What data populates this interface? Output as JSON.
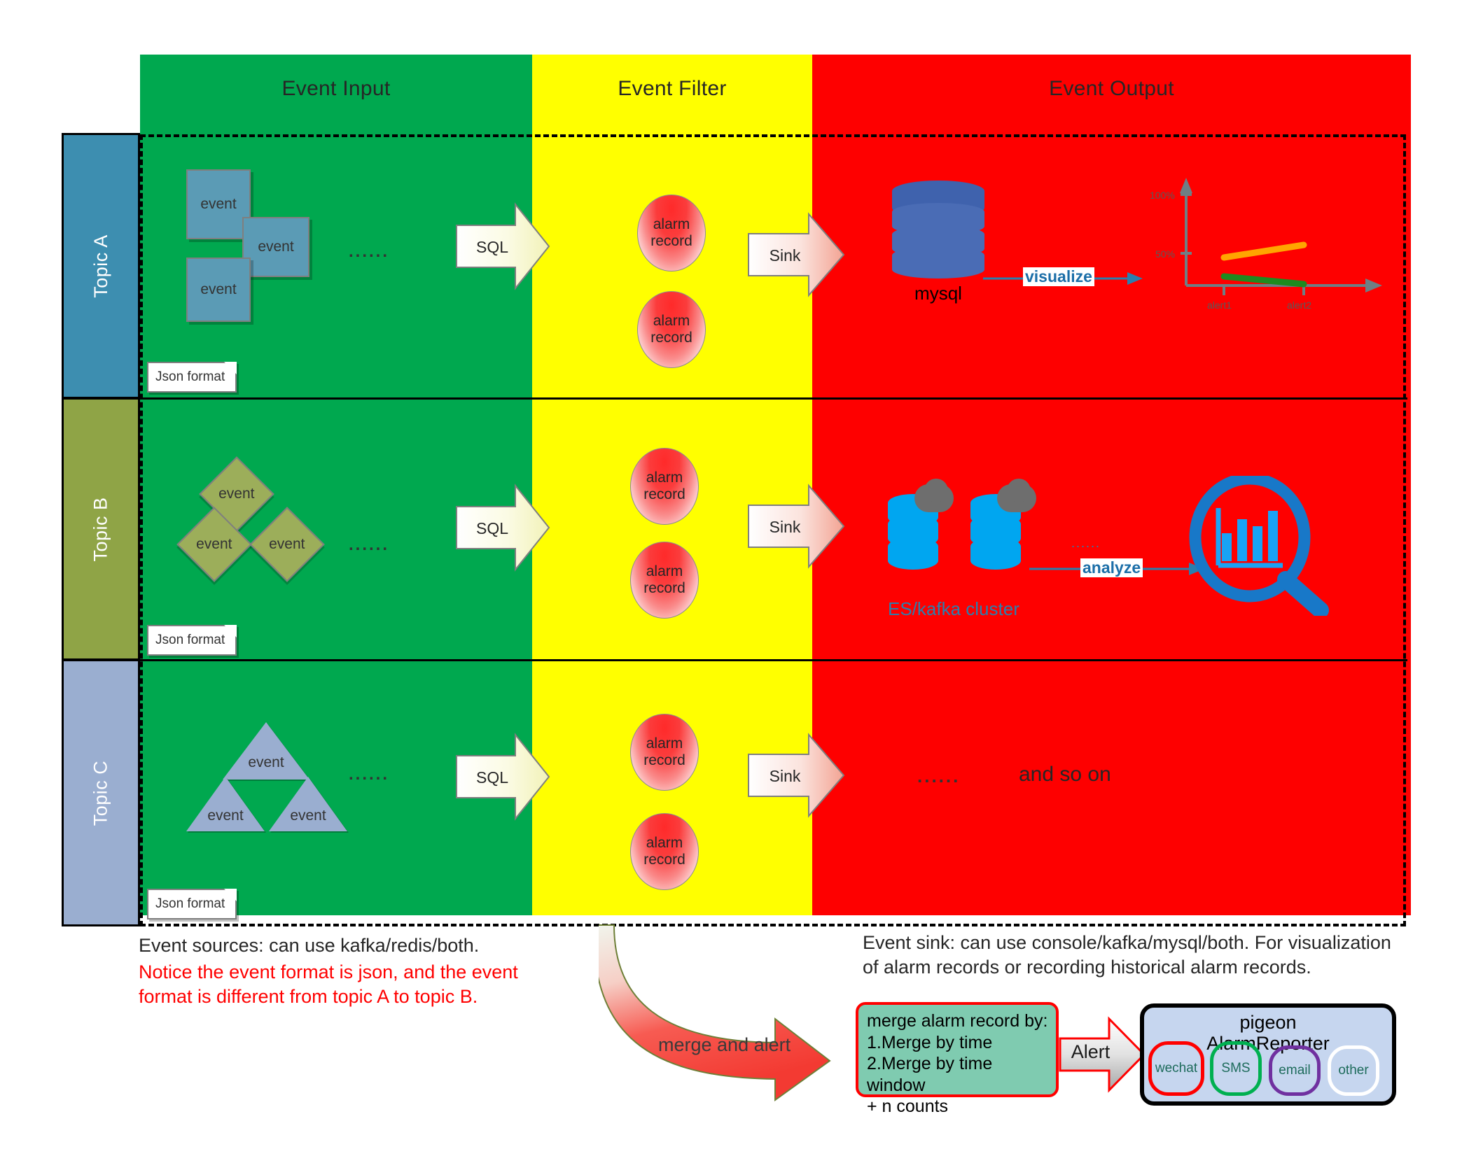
{
  "columns": [
    {
      "key": "input",
      "title": "Event Input",
      "color": "#00a84f"
    },
    {
      "key": "filter",
      "title": "Event Filter",
      "color": "#ffff00"
    },
    {
      "key": "output",
      "title": "Event Output",
      "color": "#fe0000"
    }
  ],
  "rows": [
    {
      "topic": "Topic A",
      "topic_color": "#3d8eb0",
      "shape": "rectangle",
      "event_fill": "#5b9bb5",
      "events": [
        "event",
        "event",
        "event"
      ],
      "ellipsis": "......",
      "json_note": "Json format",
      "sql_label": "SQL",
      "sink_label": "Sink",
      "alarms": [
        "alarm\nrecord",
        "alarm\nrecord"
      ]
    },
    {
      "topic": "Topic B",
      "topic_color": "#8fa446",
      "shape": "diamond",
      "event_fill": "#9cae5a",
      "events": [
        "event",
        "event",
        "event"
      ],
      "ellipsis": "......",
      "json_note": "Json format",
      "sql_label": "SQL",
      "sink_label": "Sink",
      "alarms": [
        "alarm\nrecord",
        "alarm\nrecord"
      ]
    },
    {
      "topic": "Topic C",
      "topic_color": "#9aaed0",
      "shape": "triangle",
      "event_fill": "#9aaed0",
      "events": [
        "event",
        "event",
        "event"
      ],
      "ellipsis": "......",
      "json_note": "Json format",
      "sql_label": "SQL",
      "sink_label": "Sink",
      "alarms": [
        "alarm\nrecord",
        "alarm\nrecord"
      ]
    }
  ],
  "alarm_label_line1": "alarm",
  "alarm_label_line2": "record",
  "output_row_a": {
    "db_label": "mysql",
    "connector_label": "visualize",
    "chart": {
      "y_ticks": [
        "100%",
        "50%"
      ],
      "x_ticks": [
        "alert1",
        "alert2"
      ],
      "series": [
        {
          "name": "orange-line",
          "color": "#ffa500"
        },
        {
          "name": "green-line",
          "color": "#1f8a1f"
        }
      ]
    }
  },
  "output_row_b": {
    "cluster_label": "ES/kafka cluster",
    "connector_label": "analyze",
    "ellipsis": "......"
  },
  "output_row_c": {
    "ellipsis": "......",
    "and_so_on": "and so on"
  },
  "bottom_left_note": {
    "line1": "Event sources: can use kafka/redis/both.",
    "red_lines": "Notice the event format is json, and the event format is different from topic A to topic B."
  },
  "bottom_right_note": {
    "text": "Event sink: can use console/kafka/mysql/both. For visualization of alarm records or recording historical alarm records."
  },
  "merge_arrow_label": "merge and alert",
  "merge_box": {
    "line1": "merge alarm record by:",
    "line2": "1.Merge by time",
    "line3": "2.Merge by time window",
    "line4": "+ n counts"
  },
  "alert_arrow_label": "Alert",
  "pigeon": {
    "title_line1": "pigeon",
    "title_line2": "AlarmReporter",
    "channels": [
      {
        "label": "wechat",
        "color": "#ff0000"
      },
      {
        "label": "SMS",
        "color": "#00b050"
      },
      {
        "label": "email",
        "color": "#7030a0"
      },
      {
        "label": "other",
        "color": "#ffffff"
      }
    ]
  },
  "chart_data": {
    "type": "line",
    "title": "",
    "x": [
      "alert1",
      "alert2"
    ],
    "series": [
      {
        "name": "orange",
        "values": [
          48,
          58
        ],
        "color": "#ffa500"
      },
      {
        "name": "green",
        "values": [
          34,
          24
        ],
        "color": "#1f8a1f"
      }
    ],
    "xlabel": "",
    "ylabel": "",
    "ylim": [
      0,
      110
    ],
    "ytick_labels": [
      "50%",
      "100%"
    ],
    "ytick_values": [
      50,
      100
    ],
    "grid": false,
    "legend": "none"
  }
}
